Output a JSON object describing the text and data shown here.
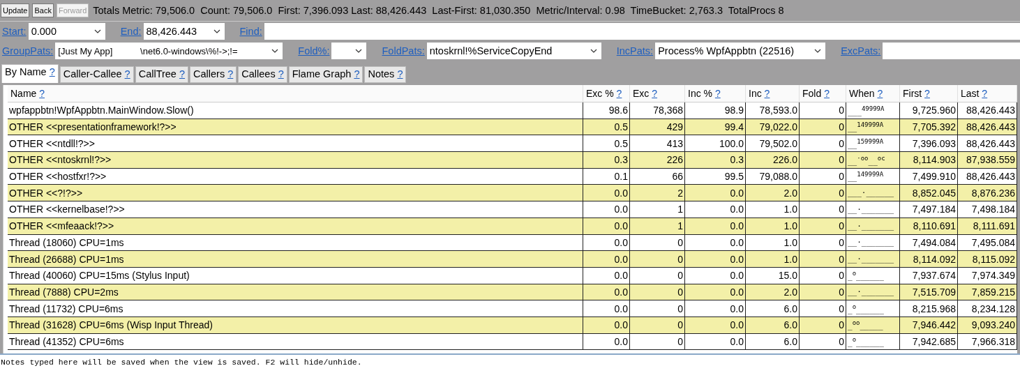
{
  "toolbar": {
    "buttons": [
      {
        "label": "Update",
        "disabled": false
      },
      {
        "label": "Back",
        "disabled": false
      },
      {
        "label": "Forward",
        "disabled": true
      }
    ],
    "summary": "Totals Metric: 79,506.0  Count: 79,506.0  First: 7,396.093 Last: 88,426.443  Last-First: 81,030.350  Metric/Interval: 0.98  TimeBucket: 2,763.3  TotalProcs 8"
  },
  "range_row": [
    {
      "label": "Start:",
      "value": "0.000",
      "kind": "combo"
    },
    {
      "label": "End:",
      "value": "88,426.443",
      "kind": "combo"
    },
    {
      "label": "Find:",
      "kind": "text"
    }
  ],
  "pattern_row": [
    {
      "label": "GroupPats:",
      "value": "[Just My App]           \\net6.0-windows\\%!->;!=",
      "kind": "combo"
    },
    {
      "label": "Fold%:",
      "kind": "combo"
    },
    {
      "label": "FoldPats:",
      "value": "ntoskrnl!%ServiceCopyEnd",
      "kind": "combo"
    },
    {
      "label": "IncPats:",
      "value": "Process% WpfAppbtn (22516)",
      "kind": "combo"
    },
    {
      "label": "ExcPats:",
      "kind": "text"
    }
  ],
  "tabs": [
    {
      "label": "By Name",
      "help": "?",
      "selected": true
    },
    {
      "label": "Caller-Callee",
      "help": "?",
      "selected": false
    },
    {
      "label": "CallTree",
      "help": "?",
      "selected": false
    },
    {
      "label": "Callers",
      "help": "?",
      "selected": false
    },
    {
      "label": "Callees",
      "help": "?",
      "selected": false
    },
    {
      "label": "Flame Graph",
      "help": "?",
      "selected": false
    },
    {
      "label": "Notes",
      "help": "?",
      "selected": false
    }
  ],
  "table": {
    "columns": [
      {
        "label": "Name",
        "help": "?"
      },
      {
        "label": "Exc %",
        "help": "?"
      },
      {
        "label": "Exc",
        "help": "?"
      },
      {
        "label": "Inc %",
        "help": "?"
      },
      {
        "label": "Inc",
        "help": "?"
      },
      {
        "label": "Fold",
        "help": "?"
      },
      {
        "label": "When",
        "help": "?"
      },
      {
        "label": "First",
        "help": "?"
      },
      {
        "label": "Last",
        "help": "?"
      }
    ],
    "rows": [
      [
        "wpfappbtn!WpfAppbtn.MainWindow.Slow()",
        "98.6",
        "78,368",
        "98.9",
        "78,593.0",
        "0",
        "___$^{49999A}$",
        "9,725.960",
        "88,426.443"
      ],
      [
        "OTHER <<presentationframework!?>>",
        "0.5",
        "429",
        "99.4",
        "79,022.0",
        "0",
        "__$^{149999A}$",
        "7,705.392",
        "88,426.443"
      ],
      [
        "OTHER <<ntdll!?>>",
        "0.5",
        "413",
        "100.0",
        "79,502.0",
        "0",
        "__$^{159999A}$",
        "7,396.093",
        "88,426.443"
      ],
      [
        "OTHER <<ntoskrnl!?>>",
        "0.3",
        "226",
        "0.3",
        "226.0",
        "0",
        "__$^{·oo}$__$^{oc}$",
        "8,114.903",
        "87,938.559"
      ],
      [
        "OTHER <<hostfxr!?>>",
        "0.1",
        "66",
        "99.5",
        "79,088.0",
        "0",
        "__$^{149999A}$",
        "7,499.910",
        "88,426.443"
      ],
      [
        "OTHER <<?!?>>",
        "0.0",
        "2",
        "0.0",
        "2.0",
        "0",
        "___·______",
        "8,852.045",
        "8,876.236"
      ],
      [
        "OTHER <<kernelbase!?>>",
        "0.0",
        "1",
        "0.0",
        "1.0",
        "0",
        "__·_______",
        "7,497.184",
        "7,498.184"
      ],
      [
        "OTHER <<mfeaack!?>>",
        "0.0",
        "1",
        "0.0",
        "1.0",
        "0",
        "__·_______",
        "8,110.691",
        "8,111.691"
      ],
      [
        "Thread (18060) CPU=1ms",
        "0.0",
        "0",
        "0.0",
        "1.0",
        "0",
        "__·_______",
        "7,494.084",
        "7,495.084"
      ],
      [
        "Thread (26688) CPU=1ms",
        "0.0",
        "0",
        "0.0",
        "1.0",
        "0",
        "__·_______",
        "8,114.092",
        "8,115.092"
      ],
      [
        "Thread (40060) CPU=15ms (Stylus Input)",
        "0.0",
        "0",
        "0.0",
        "15.0",
        "0",
        "_$^{o}$______",
        "7,937.674",
        "7,974.349"
      ],
      [
        "Thread (7888) CPU=2ms",
        "0.0",
        "0",
        "0.0",
        "2.0",
        "0",
        "__·_______",
        "7,515.709",
        "7,859.215"
      ],
      [
        "Thread (11732) CPU=6ms",
        "0.0",
        "0",
        "0.0",
        "6.0",
        "0",
        "_$^{o}$______",
        "8,215.968",
        "8,234.128"
      ],
      [
        "Thread (31628) CPU=6ms (Wisp Input Thread)",
        "0.0",
        "0",
        "0.0",
        "6.0",
        "0",
        "_$^{oo}$_____",
        "7,946.442",
        "9,093.240"
      ],
      [
        "Thread (41352) CPU=6ms",
        "0.0",
        "0",
        "0.0",
        "6.0",
        "0",
        "_$^{o}$______",
        "7,942.685",
        "7,966.318"
      ]
    ]
  },
  "notes": "Notes typed here will be saved when the view is saved. F2 will hide/unhide."
}
